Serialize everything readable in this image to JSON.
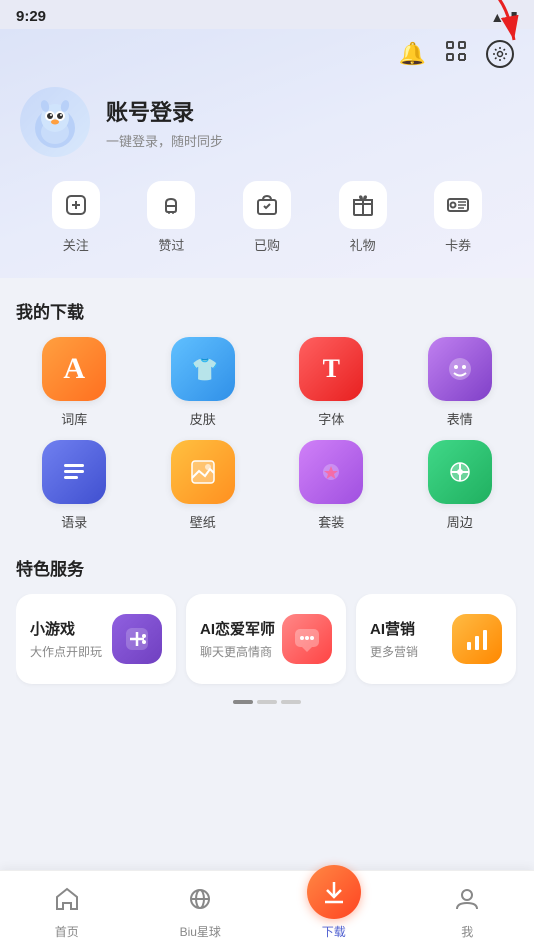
{
  "statusBar": {
    "time": "9:29",
    "icons": [
      "notification",
      "ghost",
      "square",
      "A"
    ]
  },
  "header": {
    "notificationIcon": "🔔",
    "scanIcon": "⊡",
    "settingsIconLabel": "settings",
    "userName": "账号登录",
    "userSub": "一键登录，随时同步"
  },
  "actions": [
    {
      "icon": "➕",
      "label": "关注"
    },
    {
      "icon": "👍",
      "label": "赞过"
    },
    {
      "icon": "🛍️",
      "label": "已购"
    },
    {
      "icon": "🎁",
      "label": "礼物"
    },
    {
      "icon": "🎫",
      "label": "卡券"
    }
  ],
  "downloads": {
    "title": "我的下载",
    "items": [
      {
        "icon": "A",
        "label": "词库",
        "color": "orange"
      },
      {
        "icon": "👕",
        "label": "皮肤",
        "color": "blue"
      },
      {
        "icon": "T",
        "label": "字体",
        "color": "red"
      },
      {
        "icon": "🙂",
        "label": "表情",
        "color": "purple"
      },
      {
        "icon": "≡",
        "label": "语录",
        "color": "indigo"
      },
      {
        "icon": "🖼️",
        "label": "壁纸",
        "color": "yellow"
      },
      {
        "icon": "❤️",
        "label": "套装",
        "color": "violet"
      },
      {
        "icon": "⏻",
        "label": "周边",
        "color": "green"
      }
    ]
  },
  "services": {
    "title": "特色服务",
    "items": [
      {
        "title": "小游戏",
        "sub": "大作点开即玩",
        "icon": "🎮",
        "color": "purple"
      },
      {
        "title": "AI恋爱军师",
        "sub": "聊天更高情商",
        "icon": "💬",
        "color": "pink"
      },
      {
        "title": "AI营销",
        "sub": "更多营销",
        "icon": "📊",
        "color": "orange"
      }
    ]
  },
  "bottomNav": [
    {
      "icon": "🏠",
      "label": "首页",
      "active": false
    },
    {
      "icon": "🪐",
      "label": "Biu星球",
      "active": false
    },
    {
      "icon": "⬇️",
      "label": "下载",
      "active": true
    },
    {
      "icon": "👤",
      "label": "我",
      "active": false
    }
  ],
  "scrollDots": [
    true,
    false,
    false
  ]
}
